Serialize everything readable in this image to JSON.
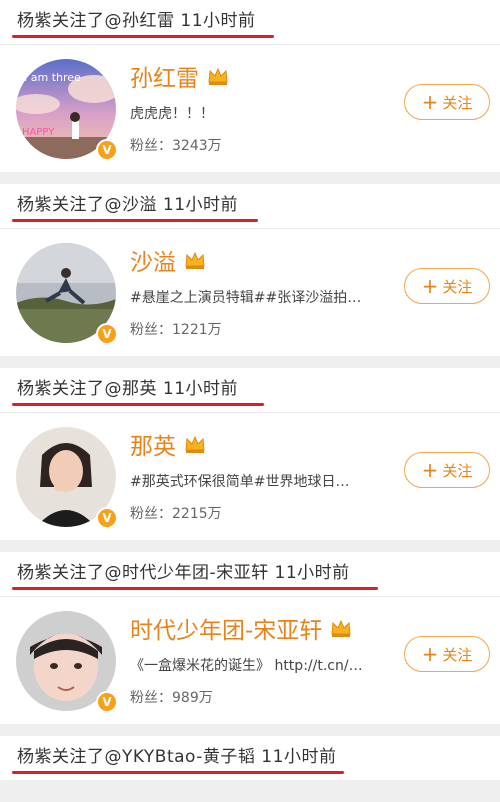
{
  "feed": [
    {
      "header": "杨紫关注了@孙红雷 11小时前",
      "user": {
        "name": "孙红雷",
        "desc": "虎虎虎！！！",
        "fans": "粉丝：3243万",
        "avatar_text_top": "I am three",
        "avatar_text_bottom": "HAPPY",
        "follow_label": "关注",
        "verified_mark": "V"
      }
    },
    {
      "header": "杨紫关注了@沙溢 11小时前",
      "user": {
        "name": "沙溢",
        "desc": "#悬崖之上演员特辑##张译沙溢拍…",
        "fans": "粉丝：1221万",
        "follow_label": "关注",
        "verified_mark": "V"
      }
    },
    {
      "header": "杨紫关注了@那英 11小时前",
      "user": {
        "name": "那英",
        "desc": "#那英式环保很简单#世界地球日…",
        "fans": "粉丝：2215万",
        "follow_label": "关注",
        "verified_mark": "V"
      }
    },
    {
      "header": "杨紫关注了@时代少年团-宋亚轩 11小时前",
      "user": {
        "name": "时代少年团-宋亚轩",
        "desc": "《一盒爆米花的诞生》 http://t.cn/…",
        "fans": "粉丝：989万",
        "follow_label": "关注",
        "verified_mark": "V"
      }
    },
    {
      "header": "杨紫关注了@YKYBtao-黄子韬 11小时前"
    }
  ],
  "colors": {
    "accent": "#e8831b",
    "underline": "#d8202a",
    "verified": "#f7a11a"
  }
}
